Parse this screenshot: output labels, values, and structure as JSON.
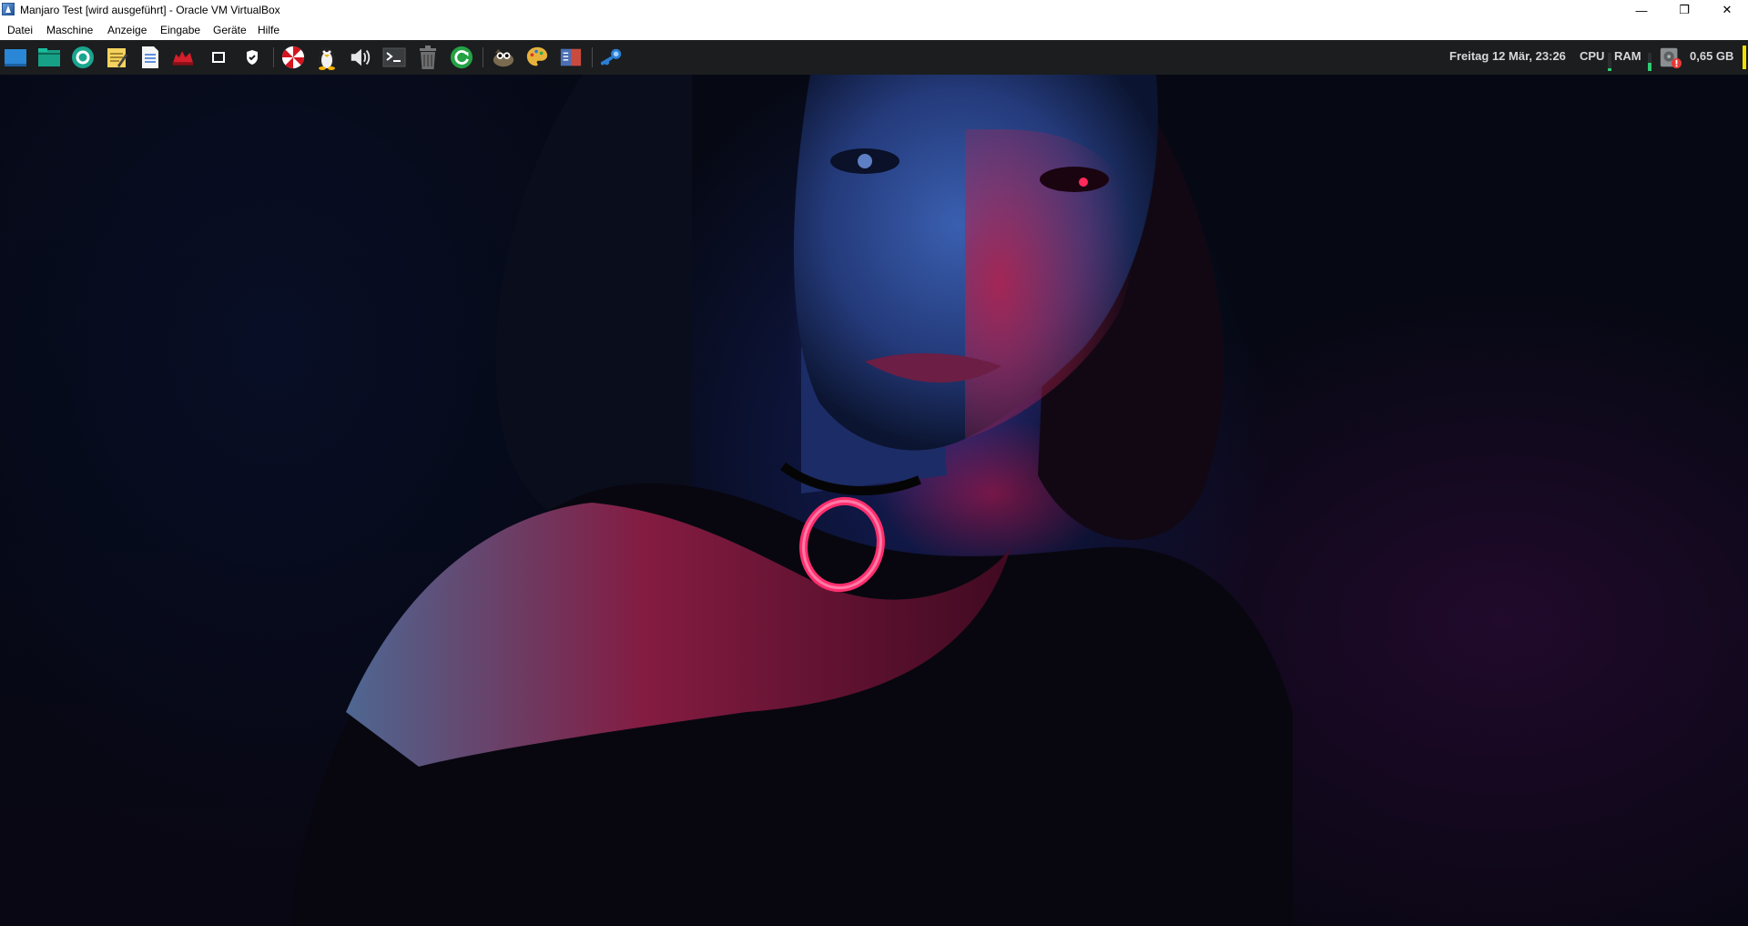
{
  "window": {
    "title": "Manjaro Test [wird ausgeführt] - Oracle VM VirtualBox",
    "minimize_glyph": "—",
    "restore_glyph": "❐",
    "close_glyph": "✕"
  },
  "menu": {
    "items": [
      "Datei",
      "Maschine",
      "Anzeige",
      "Eingabe",
      "Geräte",
      "Hilfe"
    ]
  },
  "panel": {
    "launchers": [
      {
        "icon": "show-desktop-icon"
      },
      {
        "icon": "file-manager-icon"
      },
      {
        "icon": "browser-icon"
      },
      {
        "icon": "text-editor-icon"
      },
      {
        "icon": "document-viewer-icon"
      },
      {
        "icon": "red-app-icon"
      },
      {
        "icon": "window-icon"
      },
      {
        "icon": "shield-icon"
      },
      {
        "icon": "umbrella-logo-icon"
      },
      {
        "icon": "tux-penguin-icon"
      },
      {
        "icon": "volume-icon"
      },
      {
        "icon": "terminal-icon"
      },
      {
        "icon": "trash-icon"
      },
      {
        "icon": "update-icon"
      },
      {
        "icon": "gimp-icon"
      },
      {
        "icon": "palette-icon"
      },
      {
        "icon": "screen-capture-icon"
      },
      {
        "icon": "steam-icon"
      }
    ],
    "datetime": "Freitag 12 Mär, 23:26",
    "cpu_label": "CPU",
    "ram_label": "RAM",
    "disk_free": "0,65 GB",
    "colors": {
      "cpu_bar": "#2ecc71",
      "ram_bar": "#2ecc71",
      "disk_bar": "#f1e000",
      "alert": "#e53935"
    }
  },
  "desktop": {
    "wallpaper": "neon-portrait-wallpaper"
  }
}
